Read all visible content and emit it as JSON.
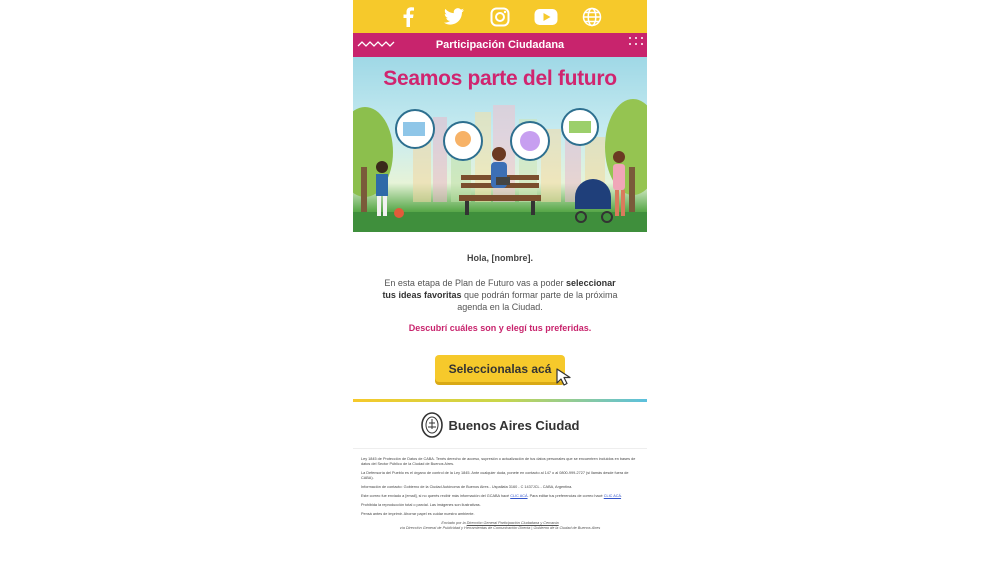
{
  "social": {
    "icons": [
      "facebook-icon",
      "twitter-icon",
      "instagram-icon",
      "youtube-icon",
      "globe-icon"
    ]
  },
  "band": {
    "title": "Participación Ciudadana"
  },
  "hero": {
    "title": "Seamos parte del futuro"
  },
  "body": {
    "greeting": "Hola, [nombre].",
    "intro_1": "En esta etapa de Plan de Futuro vas a poder ",
    "intro_bold": "seleccionar tus ideas favoritas",
    "intro_2": " que podrán formar parte de la próxima agenda en la Ciudad.",
    "discover": "Descubrí cuáles son y elegí tus preferidas.",
    "cta": "Seleccionalas acá"
  },
  "footer": {
    "logo_text": "Buenos Aires Ciudad",
    "legal_1": "Ley 1845 de Protección de Datos de CABA. Tenés derecho de acceso, supresión o actualización de tus datos personales que se encuentren incluidos en bases de datos del Sector Público de la Ciudad de Buenos Aires.",
    "legal_2": "La Defensoría del Pueblo es el órgano de control de la Ley 1845. Ante cualquier duda, ponete en contacto al 147 o al 0800-999-2727 (si llamás desde fuera de CABA).",
    "legal_3": "Información de contacto: Gobierno de la Ciudad Autónoma de Buenos Aires - Uspallata 3160 - C 1437JCL - CABA, Argentina.",
    "legal_4a": "Este correo fue enviado a [email], si no querés recibir más información del GCABA hacé ",
    "legal_4_link1": "CLIC ACÁ",
    "legal_4b": ". Para editar tus preferencias de correo hacé ",
    "legal_4_link2": "CLIC ACÁ",
    "legal_4c": ".",
    "legal_5": "Prohibida la reproducción total o parcial. Las imágenes son ilustrativas.",
    "legal_6": "Pensá antes de imprimir. Ahorrar papel es cuidar nuestro ambiente.",
    "sent_1a": "Enviado por la ",
    "sent_1b": "Dirección General Participación Ciudadana y Cercanía",
    "sent_2": "vía Dirección General de Publicidad y Herramientas de Comunicación Directa | Gobierno de la Ciudad de Buenos Aires"
  },
  "colors": {
    "yellow": "#f6c92b",
    "magenta": "#c8246d"
  }
}
